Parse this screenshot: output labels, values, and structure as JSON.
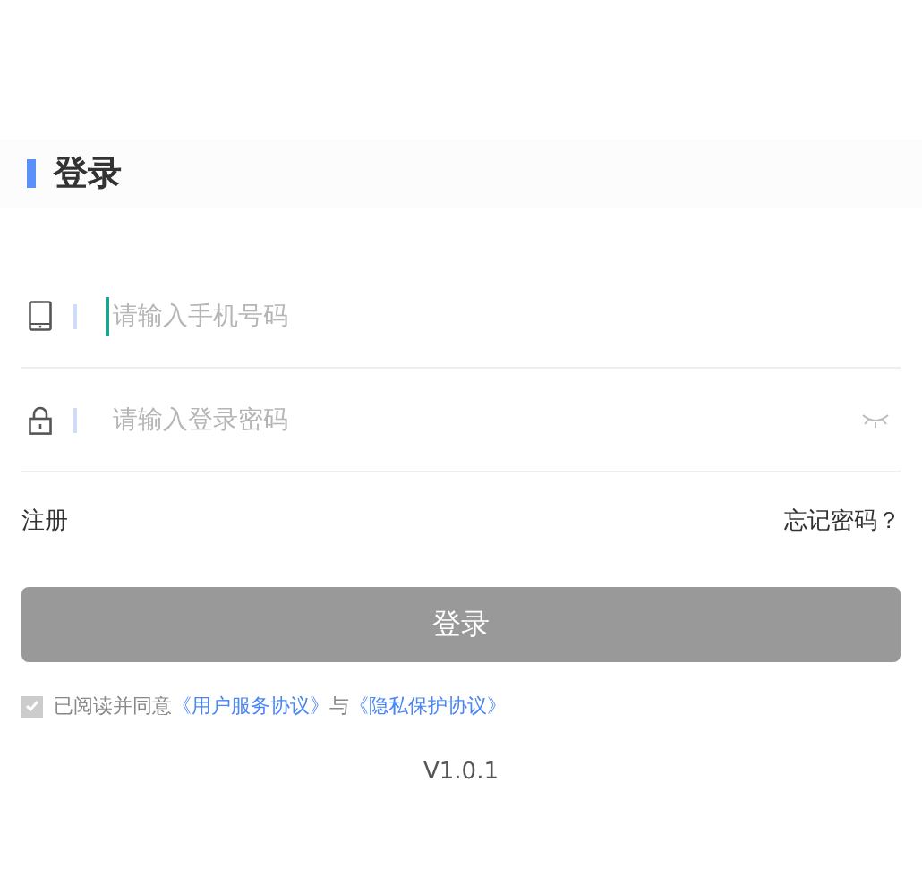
{
  "header": {
    "title": "登录"
  },
  "fields": [
    {
      "kind": "phone",
      "placeholder": "请输入手机号码",
      "focused": true
    },
    {
      "kind": "password",
      "placeholder": "请输入登录密码",
      "focused": false
    }
  ],
  "links": {
    "register": "注册",
    "forgot": "忘记密码？"
  },
  "submit": {
    "label": "登录",
    "disabled": true
  },
  "agreement": {
    "checked": true,
    "parts": [
      {
        "kind": "text",
        "text": "已阅读并同意"
      },
      {
        "kind": "link",
        "text": "《用户服务协议》"
      },
      {
        "kind": "text",
        "text": "与"
      },
      {
        "kind": "link",
        "text": "《隐私保护协议》"
      }
    ]
  },
  "version": "V1.0.1"
}
